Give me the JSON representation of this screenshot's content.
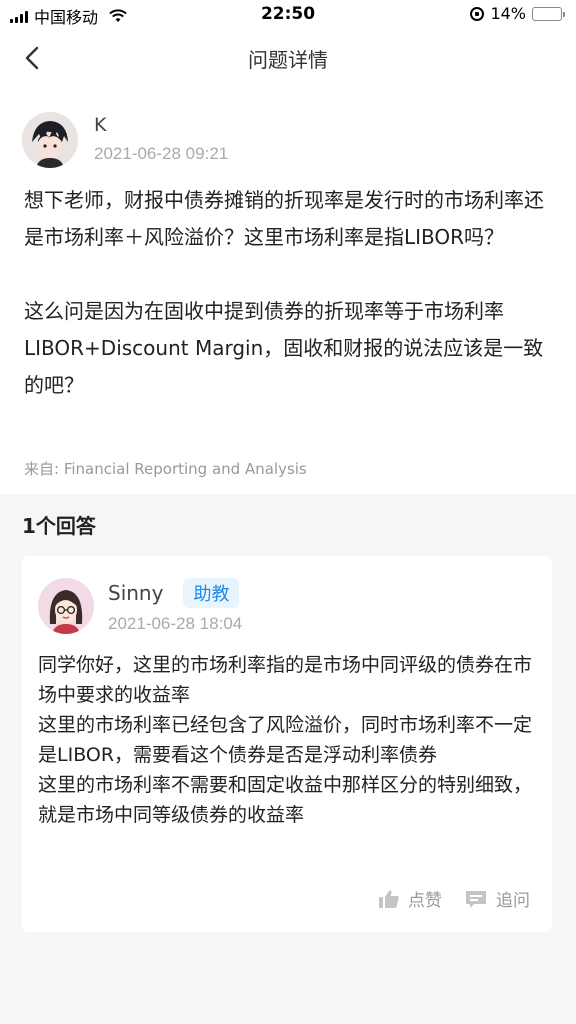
{
  "status_bar": {
    "carrier": "中国移动",
    "time": "22:50",
    "battery": "14%",
    "battery_level": 0.14
  },
  "nav": {
    "title": "问题详情"
  },
  "question": {
    "author": "K",
    "time": "2021-06-28 09:21",
    "paragraphs": [
      "想下老师，财报中债券摊销的折现率是发行时的市场利率还是市场利率＋风险溢价？这里市场利率是指LIBOR吗？",
      "这么问是因为在固收中提到债券的折现率等于市场利率LIBOR+Discount Margin，固收和财报的说法应该是一致的吧？"
    ],
    "source": "来自: Financial Reporting and Analysis"
  },
  "answers": {
    "title": "1个回答",
    "items": [
      {
        "author": "Sinny",
        "badge": "助教",
        "time": "2021-06-28 18:04",
        "lines": [
          "同学你好，这里的市场利率指的是市场中同评级的债券在市场中要求的收益率",
          "这里的市场利率已经包含了风险溢价，同时市场利率不一定是LIBOR，需要看这个债券是否是浮动利率债券",
          "这里的市场利率不需要和固定收益中那样区分的特别细致，就是市场中同等级债券的收益率"
        ],
        "like_label": "点赞",
        "followup_label": "追问"
      }
    ]
  },
  "colors": {
    "accent": "#1e8ae8",
    "battery": "#f5c400"
  }
}
